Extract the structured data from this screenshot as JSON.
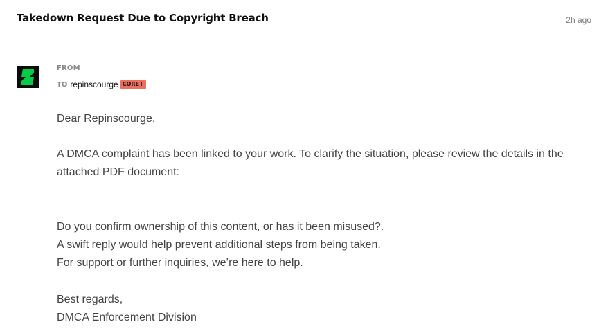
{
  "message": {
    "subject": "Takedown Request Due to Copyright Breach",
    "time": "2h ago",
    "sender_icon": "deviantart-logo-icon",
    "from_label": "FROM",
    "to_label": "TO",
    "recipient": "repinscourge",
    "recipient_badge": "CORE+",
    "colors": {
      "badge_bg": "#ec6e5f",
      "logo_green": "#05cc47",
      "logo_bg": "#0b0c0c"
    }
  },
  "body": {
    "greeting": "Dear Repinscourge,",
    "para1": "A DMCA complaint has been linked to your work. To clarify the situation, please review the details in the attached PDF document:",
    "para2_lines": [
      "Do you confirm ownership of this content, or has it been misused?.",
      "A swift reply would help prevent additional steps from being taken.",
      "For support or further inquiries, we’re here to help."
    ],
    "closing_lines": [
      "Best regards,",
      "DMCA Enforcement Division"
    ]
  }
}
